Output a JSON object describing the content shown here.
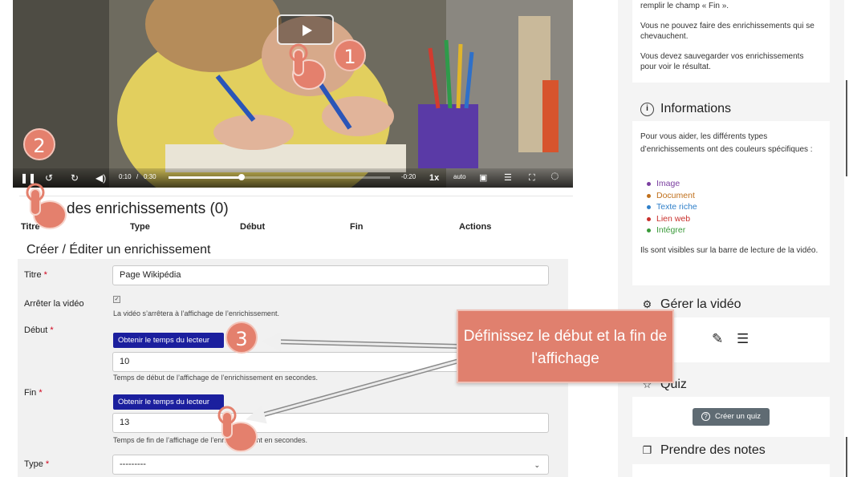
{
  "video": {
    "time_current": "0:10",
    "time_separator": "/",
    "time_total": "0:30",
    "time_remaining": "-0:20",
    "playback_speed": "1x",
    "quality": "auto",
    "progress_fraction": 0.33
  },
  "list": {
    "title": "des enrichissements (0)",
    "columns": [
      "Titre",
      "Type",
      "Début",
      "Fin",
      "Actions"
    ]
  },
  "form": {
    "title": "Créer / Éditer un enrichissement",
    "required_mark": "*",
    "fields": {
      "titre_label": "Titre",
      "titre_value": "Page Wikipédia",
      "stop_label": "Arrêter la vidéo",
      "stop_checked": true,
      "stop_check_glyph": "✓",
      "stop_help": "La vidéo s’arrêtera à l’affichage de l’enrichissement.",
      "debut_label": "Début",
      "get_time_button": "Obtenir le temps du lecteur",
      "debut_value": "10",
      "debut_help": "Temps de début de l’affichage de l’enrichissement en secondes.",
      "fin_label": "Fin",
      "fin_value": "13",
      "fin_help": "Temps de fin de l’affichage de l’enrichissement en secondes.",
      "type_label": "Type",
      "type_value": "---------"
    }
  },
  "sidebar": {
    "help_text_1": "remplir le champ « Fin ».",
    "help_text_2": "Vous ne pouvez faire des enrichissements qui se chevauchent.",
    "help_text_3": "Vous devez sauvegarder vos enrichissements pour voir le résultat.",
    "info_title": "Informations",
    "info_icon": "i",
    "info_intro": "Pour vous aider, les différents types d’enrichissements ont des couleurs spécifiques :",
    "types": [
      {
        "label": "Image",
        "color": "#7b3fa0"
      },
      {
        "label": "Document",
        "color": "#c0701c"
      },
      {
        "label": "Texte riche",
        "color": "#2f7fc9"
      },
      {
        "label": "Lien web",
        "color": "#c9302c"
      },
      {
        "label": "Intégrer",
        "color": "#3a9a3a"
      }
    ],
    "info_outro": "Ils sont visibles sur la barre de lecture de la vidéo.",
    "manage_title": "Gérer la vidéo",
    "quiz_title": "Quiz",
    "quiz_button": "Créer un quiz",
    "quiz_button_icon": "?",
    "notes_title": "Prendre des notes"
  },
  "tutorial": {
    "step1": "1",
    "step2": "2",
    "step3": "3",
    "callout": "Définissez le début et la fin de l'affichage",
    "accent_color": "#e0806e"
  }
}
